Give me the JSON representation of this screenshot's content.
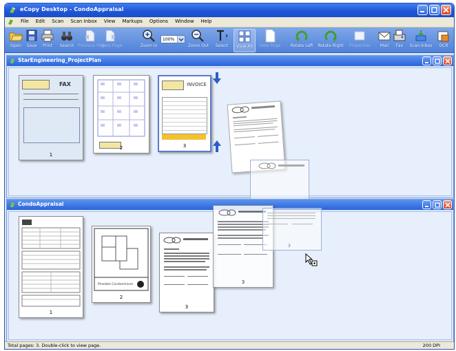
{
  "window": {
    "title": "eCopy Desktop - CondoAppraisal"
  },
  "menu": [
    "File",
    "Edit",
    "Scan",
    "Scan Inbox",
    "View",
    "Markups",
    "Options",
    "Window",
    "Help"
  ],
  "toolbar": {
    "open": "Open",
    "save": "Save",
    "print": "Print",
    "search": "Search",
    "disabled1": "Previous Page",
    "disabled2": "Next Page",
    "zoom_in": "Zoom In",
    "zoom_value": "100%",
    "zoom_out": "Zoom Out",
    "select": "Select",
    "view_all": "View All",
    "view_page": "View Page",
    "rotate_left": "Rotate Left",
    "rotate_right": "Rotate Right",
    "disabled3": "Properties",
    "mail": "Mail",
    "fax": "Fax",
    "scan_inbox": "Scan Inbox",
    "ocr": "OCR"
  },
  "panels": {
    "top": {
      "title": "StarEngineering_ProjectPlan",
      "pages": [
        {
          "num": "1",
          "label": "FAX"
        },
        {
          "num": "2"
        },
        {
          "num": "3",
          "label": "INVOICE"
        }
      ]
    },
    "bottom": {
      "title": "CondoAppraisal",
      "pages": [
        {
          "num": "1"
        },
        {
          "num": "2",
          "label": "Pinelake Condominium"
        },
        {
          "num": "3"
        },
        {
          "num": "3"
        }
      ]
    },
    "floating_num": "3"
  },
  "status": {
    "text": "Total pages: 3. Double-click to view page.",
    "dpi": "200 DPI"
  },
  "colors": {
    "title_bar": "#1e56d6",
    "toolbar": "#4f82d9",
    "panel_bg": "#e6effb",
    "accent_arrow": "#2a5ec8",
    "invoice_yellow": "#f3c22f"
  }
}
